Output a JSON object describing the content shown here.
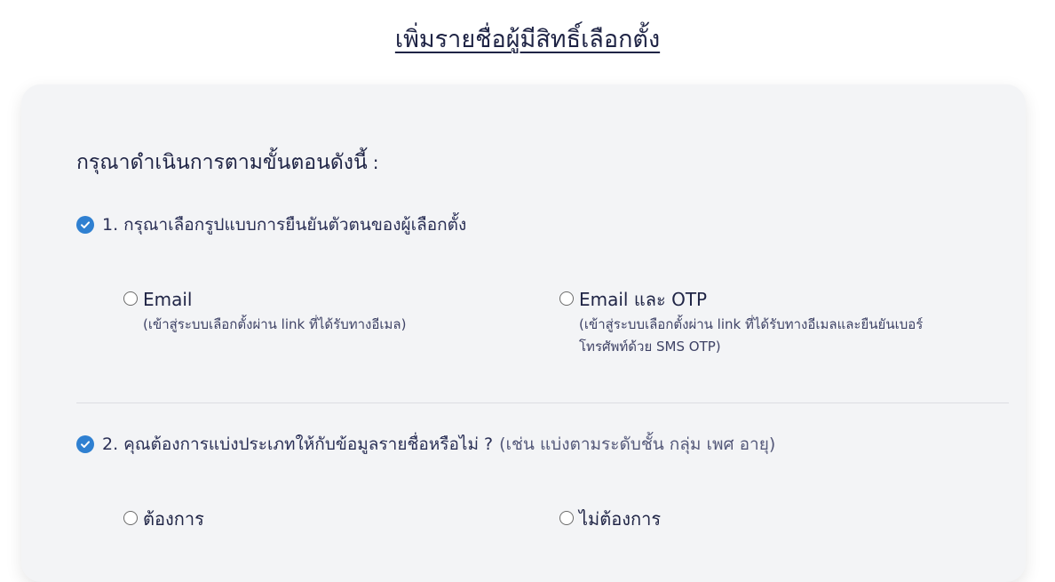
{
  "title": "เพิ่มรายชื่อผู้มีสิทธิ์เลือกตั้ง",
  "intro": "กรุณาดำเนินการตามขั้นตอนดังนี้",
  "intro_colon": ":",
  "step1": {
    "label": "1. กรุณาเลือกรูปแบบการยืนยันตัวตนของผู้เลือกตั้ง",
    "icon": "check-circle-icon",
    "options": [
      {
        "label": "Email",
        "desc": "(เข้าสู่ระบบเลือกตั้งผ่าน link ที่ได้รับทางอีเมล)"
      },
      {
        "label": "Email และ OTP",
        "desc": "(เข้าสู่ระบบเลือกตั้งผ่าน link ที่ได้รับทางอีเมลและยืนยันเบอร์โทรศัพท์ด้วย SMS OTP)"
      }
    ]
  },
  "step2": {
    "label": "2. คุณต้องการแบ่งประเภทให้กับข้อมูลรายชื่อหรือไม่ ?",
    "hint": "(เช่น แบ่งตามระดับชั้น กลุ่ม เพศ อายุ)",
    "icon": "check-circle-icon",
    "options": [
      {
        "label": "ต้องการ"
      },
      {
        "label": "ไม่ต้องการ"
      }
    ]
  },
  "colors": {
    "accent": "#2f80d1",
    "text": "#1f2445",
    "card_bg": "#f3f4f6"
  }
}
